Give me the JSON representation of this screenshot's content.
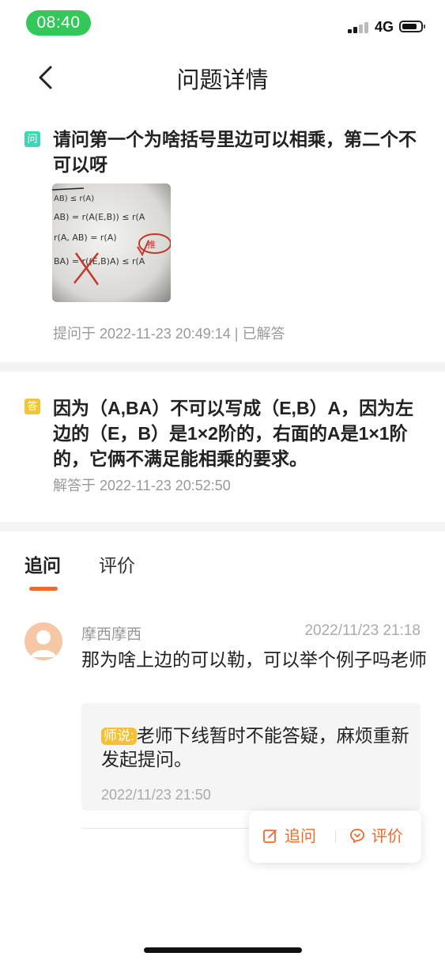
{
  "status_bar": {
    "time": "08:40",
    "network": "4G"
  },
  "nav": {
    "title": "问题详情"
  },
  "question": {
    "badge": "问",
    "text": "请问第一个为啥括号里边可以相乘，第二个不可以呀",
    "image_lines": [
      "AB) ≤ r(A)",
      "AB) = r(A(E,B)) ≤ r(A",
      "r(A, AB) = r(A)",
      "BA) = r((E,B)A) ≤ r(A"
    ],
    "image_annotation": "推",
    "meta": "提问于 2022-11-23 20:49:14 | 已解答"
  },
  "answer": {
    "badge": "答",
    "text": "因为（A,BA）不可以写成（E,B）A，因为左边的（E，B）是1×2阶的，右面的A是1×1阶的，它俩不满足能相乘的要求。",
    "meta": "解答于 2022-11-23 20:52:50"
  },
  "tabs": [
    {
      "label": "追问"
    },
    {
      "label": "评价"
    }
  ],
  "comment": {
    "user": "摩西摩西",
    "time": "2022/11/23 21:18",
    "text": "那为啥上边的可以勒，可以举个例子吗老师",
    "reply": {
      "tag": "师说:",
      "text": "老师下线暂时不能答疑，麻烦重新发起提问。",
      "time": "2022/11/23 21:50"
    }
  },
  "actions": {
    "followup": "追问",
    "review": "评价"
  },
  "colors": {
    "accent": "#f06a2a",
    "status_pill": "#34c759",
    "question_badge": "#3fd6b5",
    "answer_badge": "#f4c530"
  }
}
